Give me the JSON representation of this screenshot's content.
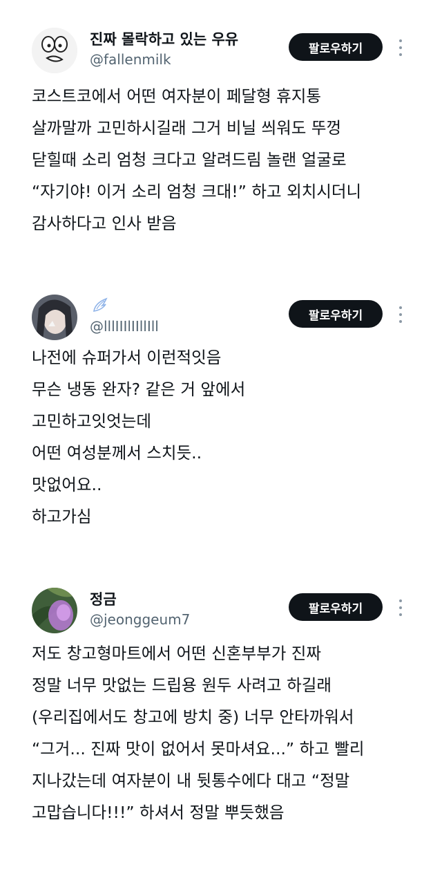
{
  "follow_label": "팔로우하기",
  "tweets": [
    {
      "display_name": "진짜 몰락하고 있는 우유",
      "handle": "@fallenmilk",
      "lines": [
        "코스트코에서 어떤 여자분이 페달형 휴지통",
        "살까말까 고민하시길래 그거 비닐 씌워도 뚜껑",
        "닫힐때 소리 엄청 크다고 알려드림 놀랜 얼굴로",
        "“자기야! 이거 소리 엄청 크대!” 하고 외치시더니",
        "감사하다고 인사 받음"
      ]
    },
    {
      "display_name": "",
      "handle": "@lllIIIlIIllIll",
      "lines": [
        "나전에 슈퍼가서 이런적잇음",
        "무슨 냉동 완자? 같은 거 앞에서",
        "고민하고잇엇는데",
        "어떤 여성분께서 스치듯..",
        "맛없어요..",
        "하고가심"
      ]
    },
    {
      "display_name": "정금",
      "handle": "@jeonggeum7",
      "lines": [
        "저도 창고형마트에서 어떤 신혼부부가 진짜",
        "정말 너무 맛없는 드립용 원두 사려고 하길래",
        "(우리집에서도 창고에 방치 중) 너무 안타까워서",
        "“그거... 진짜 맛이 없어서 못마셔요...” 하고 빨리",
        "지나갔는데 여자분이 내 뒷통수에다 대고 “정말",
        "고맙습니다!!!” 하셔서 정말 뿌듯했음"
      ]
    }
  ]
}
